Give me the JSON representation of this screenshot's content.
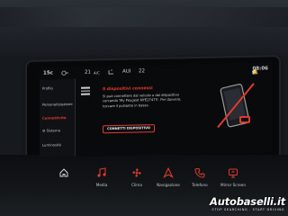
{
  "status_bar": {
    "temp_left": "15",
    "temp_left_unit": "c",
    "temp_right": "21",
    "ac_label": "A/C",
    "auto_label": "AUI",
    "right_number": "22",
    "clock": "08:06"
  },
  "sidebar": {
    "items": [
      {
        "label": "Profilo"
      },
      {
        "label": "Personalizzazione"
      },
      {
        "label": "Connettività"
      },
      {
        "label": "Sistema"
      },
      {
        "label": "Luminosità"
      }
    ],
    "active_index": 2
  },
  "dialog": {
    "title": "0 dispositivi connessi",
    "body": "Si può connettere dal veicolo o dal dispositivo cercando 'My Peugeot NYE27475'. Per davvero, toccare il pulsante in basso.",
    "button_label": "CONNETTI DISPOSITIVO"
  },
  "shortcuts": [
    {
      "label": "",
      "icon": "home-icon"
    },
    {
      "label": "Media",
      "icon": "music-note-icon"
    },
    {
      "label": "Clima",
      "icon": "fan-icon"
    },
    {
      "label": "Navigazione",
      "icon": "navigation-arrow-icon"
    },
    {
      "label": "Telefono",
      "icon": "phone-icon"
    },
    {
      "label": "Mirror Screen",
      "icon": "mirror-screen-icon"
    }
  ],
  "watermark": {
    "brand": "Autobaselli.it",
    "tagline": "STOP SEARCHING . START DRIVING"
  },
  "colors": {
    "accent": "#e23a2e",
    "screen_bg": "#090a0c",
    "text": "#dcdcdc"
  }
}
